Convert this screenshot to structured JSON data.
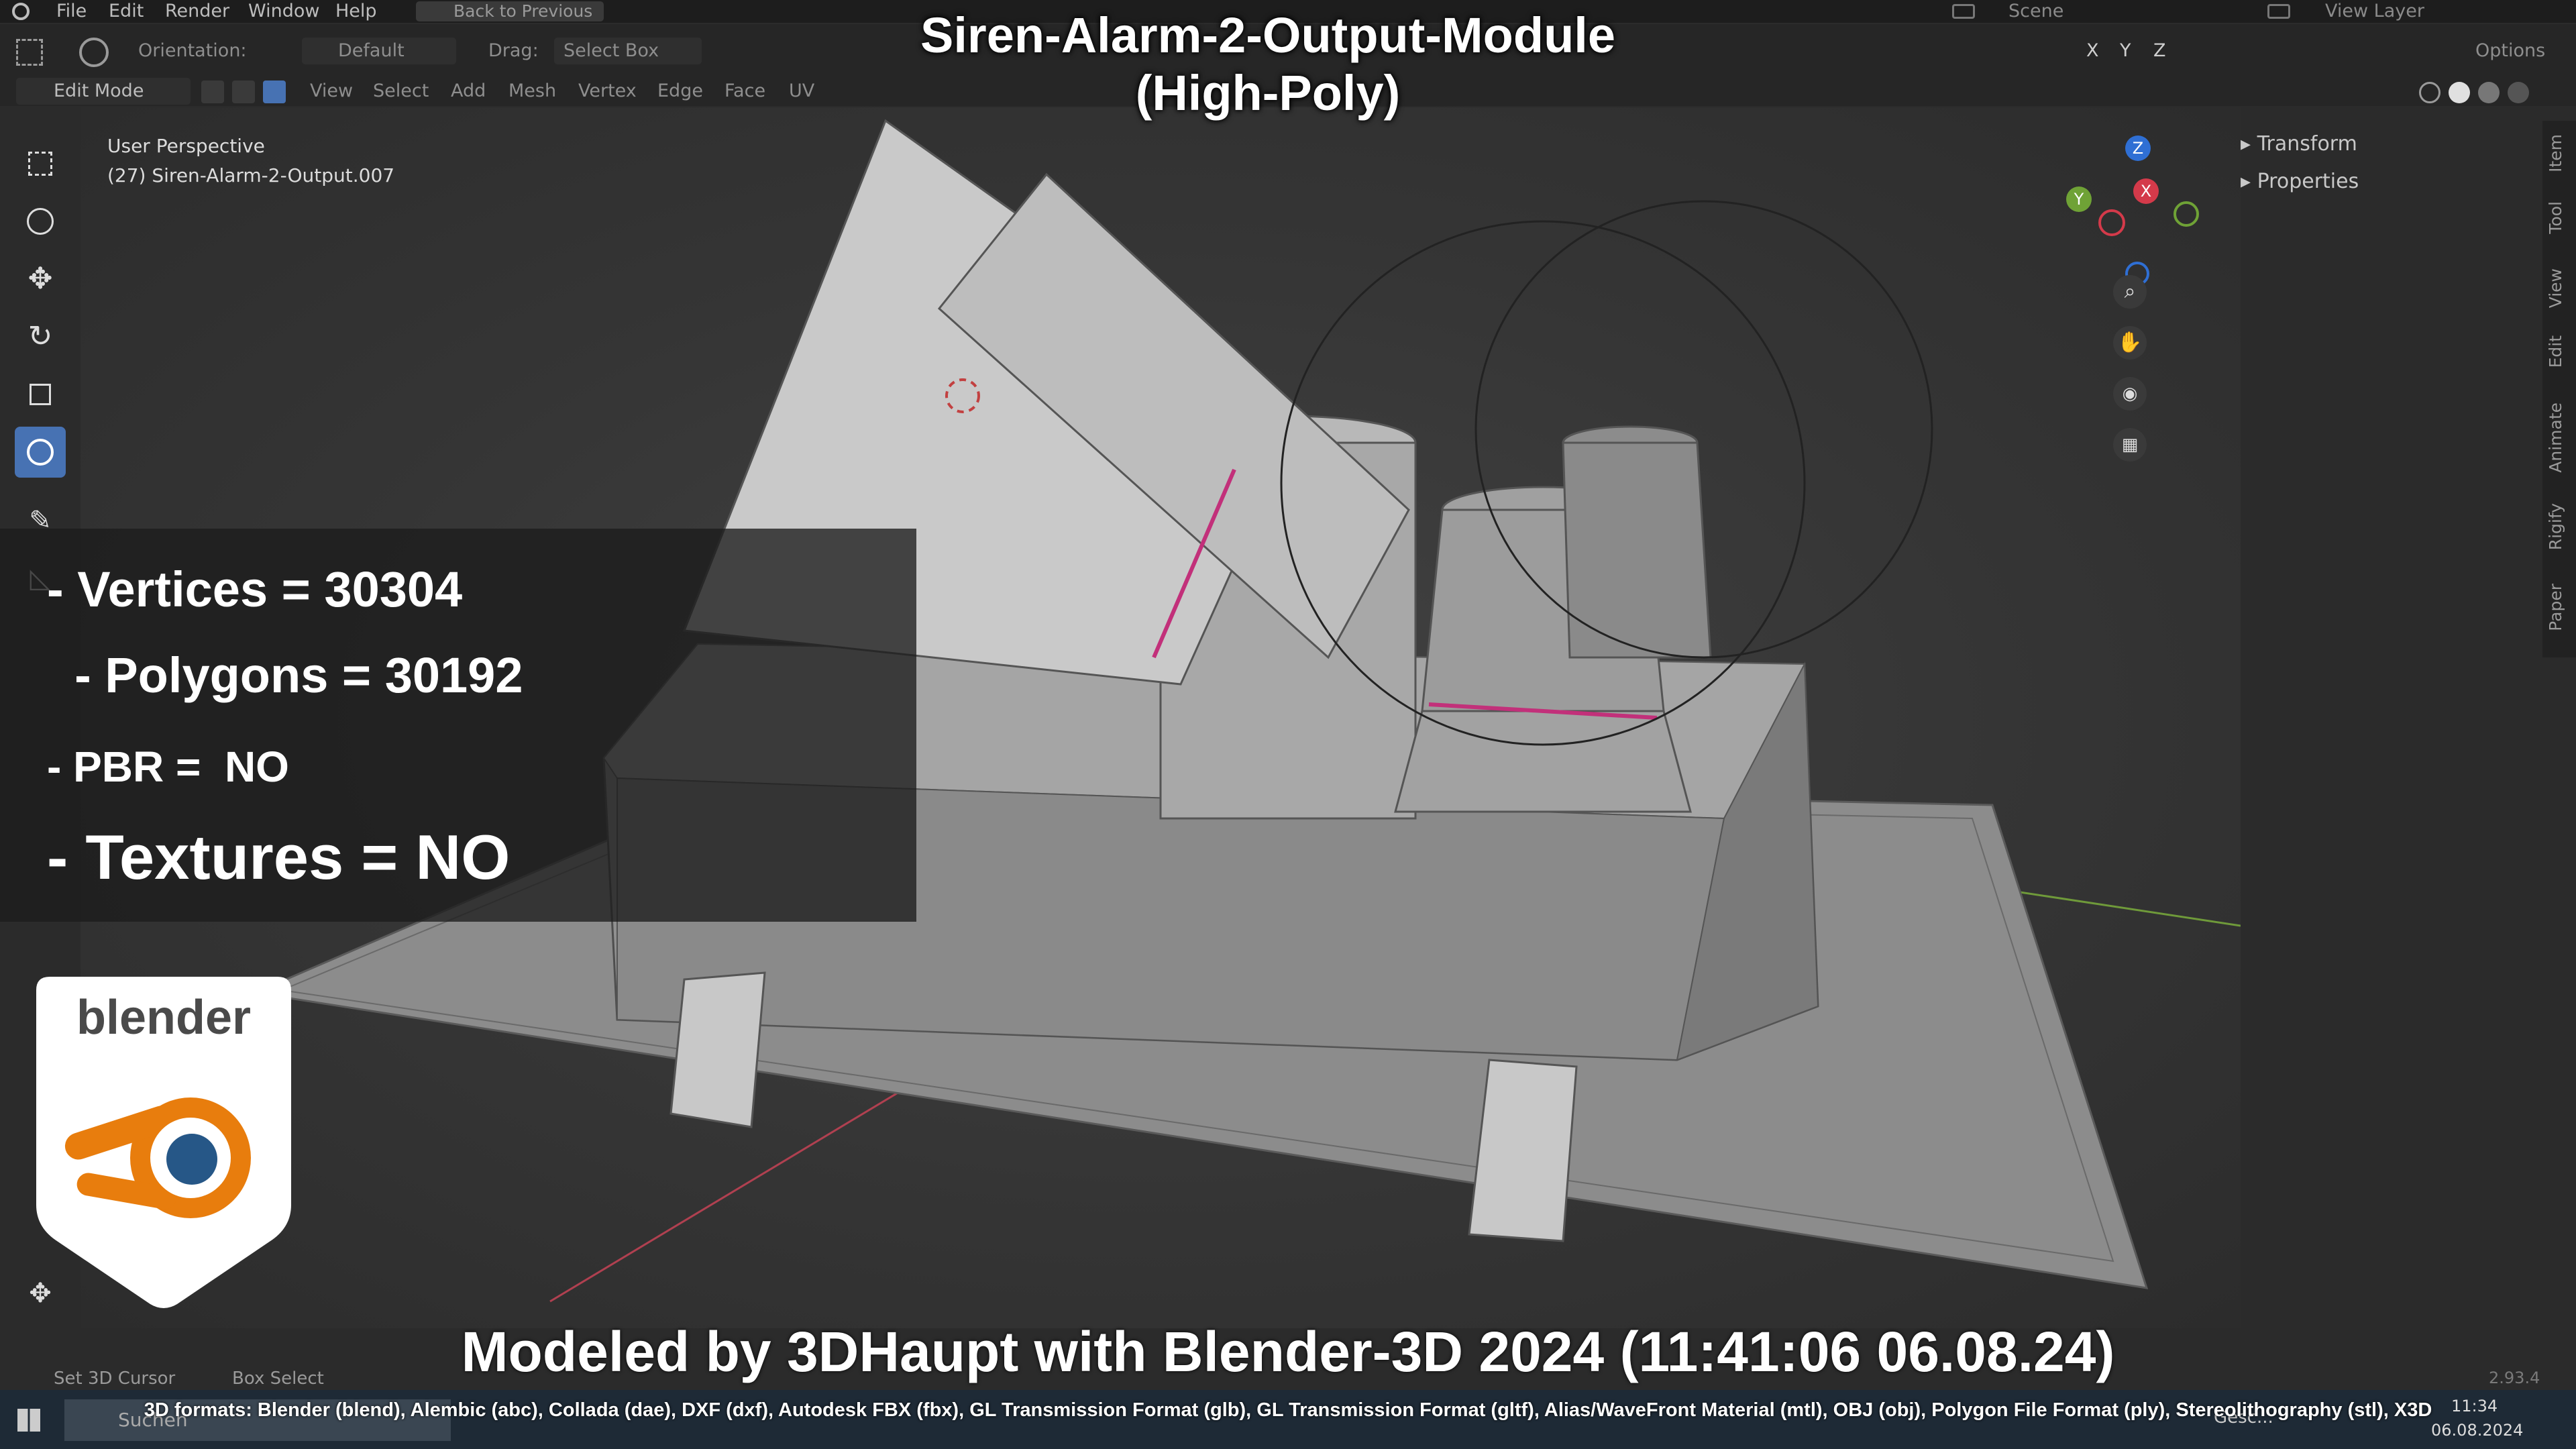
{
  "menubar": {
    "items": [
      "File",
      "Edit",
      "Render",
      "Window",
      "Help"
    ],
    "back_button": "Back to Previous",
    "scene": "Scene",
    "view_layer": "View Layer"
  },
  "toolbar": {
    "orientation_label": "Orientation:",
    "orientation_value": "Default",
    "drag_label": "Drag:",
    "drag_value": "Select Box",
    "options": "Options",
    "mode": "Edit Mode",
    "header_items": [
      "View",
      "Select",
      "Add",
      "Mesh",
      "Vertex",
      "Edge",
      "Face",
      "UV"
    ],
    "axes": [
      "X",
      "Y",
      "Z"
    ]
  },
  "viewport": {
    "perspective": "User Perspective",
    "object": "(27) Siren-Alarm-2-Output.007",
    "gizmo_axes": [
      "Z",
      "Y",
      "X"
    ]
  },
  "npanel": {
    "rows": [
      "Transform",
      "Properties"
    ],
    "tabs": [
      "Item",
      "Tool",
      "View",
      "Edit",
      "Animate",
      "Rigify",
      "Paper"
    ]
  },
  "overlay": {
    "title_line1": "Siren-Alarm-2-Output-Module",
    "title_line2": "(High-Poly)",
    "stats": [
      "- Vertices = 30304",
      "  - Polygons = 30192",
      "- PBR =  NO",
      "- Textures = NO"
    ],
    "logo_text": "blender",
    "credit": "Modeled by 3DHaupt with Blender-3D 2024 (11:41:06  06.08.24)",
    "formats": "3D formats: Blender (blend), Alembic (abc), Collada (dae), DXF (dxf), Autodesk FBX (fbx), GL Transmission Format (glb), GL Transmission Format (gltf), Alias/WaveFront Material (mtl), OBJ (obj), Polygon File Format (ply), Stereolithography (stl), X3D"
  },
  "statusbar": {
    "left": "Set 3D Cursor",
    "middle": "Box Select",
    "version": "2.93.4"
  },
  "taskbar": {
    "search": "Suchen",
    "time": "11:34",
    "date": "06.08.2024",
    "app_label": "Gesc..."
  }
}
